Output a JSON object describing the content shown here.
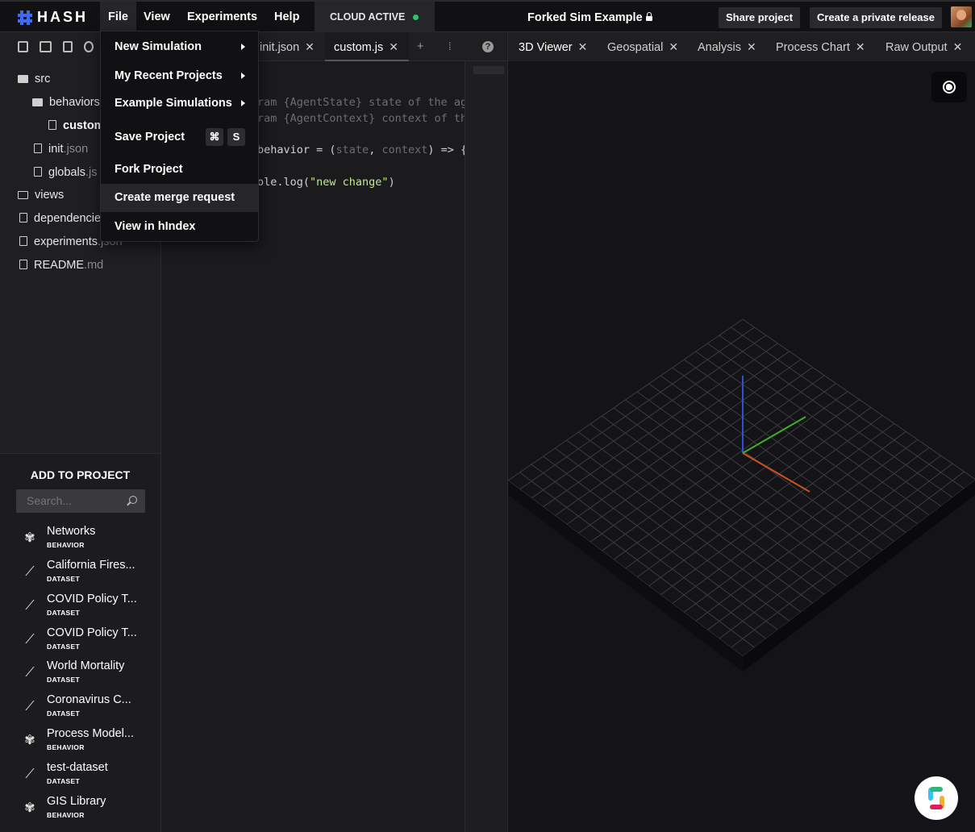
{
  "topbar": {
    "logo": "HASH",
    "menus": [
      "File",
      "View",
      "Experiments",
      "Help"
    ],
    "cloud_status": "CLOUD ACTIVE",
    "project_title": "Forked Sim Example",
    "share_label": "Share project",
    "release_label": "Create a private release"
  },
  "file_menu": {
    "items": [
      {
        "label": "New Simulation",
        "submenu": true
      },
      {
        "label": "My Recent Projects",
        "submenu": true
      },
      {
        "label": "Example Simulations",
        "submenu": true
      },
      {
        "label": "Save Project",
        "shortcut": [
          "⌘",
          "S"
        ]
      },
      {
        "label": "Fork Project"
      },
      {
        "label": "Create merge request"
      },
      {
        "label": "View in hIndex"
      }
    ]
  },
  "file_tree": {
    "src": "src",
    "behaviors": "behaviors",
    "custom": "custom",
    "init_name": "init",
    "init_ext": ".json",
    "globals_name": "globals",
    "globals_ext": ".js",
    "views": "views",
    "dependencies": "dependencie",
    "experiments_name": "experiments",
    "experiments_ext": ".json",
    "readme_name": "README",
    "readme_ext": ".md"
  },
  "add_panel": {
    "title": "ADD TO PROJECT",
    "search_placeholder": "Search...",
    "items": [
      {
        "name": "Networks",
        "type": "BEHAVIOR",
        "icon": "brain-icon"
      },
      {
        "name": "California Fires...",
        "type": "DATASET",
        "icon": "trend-icon"
      },
      {
        "name": "COVID Policy T...",
        "type": "DATASET",
        "icon": "trend-icon"
      },
      {
        "name": "COVID Policy T...",
        "type": "DATASET",
        "icon": "trend-icon"
      },
      {
        "name": "World Mortality",
        "type": "DATASET",
        "icon": "trend-icon"
      },
      {
        "name": "Coronavirus C...",
        "type": "DATASET",
        "icon": "trend-icon"
      },
      {
        "name": "Process Model...",
        "type": "BEHAVIOR",
        "icon": "brain-icon"
      },
      {
        "name": "test-dataset",
        "type": "DATASET",
        "icon": "trend-icon"
      },
      {
        "name": "GIS Library",
        "type": "BEHAVIOR",
        "icon": "brain-icon"
      }
    ]
  },
  "editor": {
    "tabs": [
      "init.json",
      "custom.js"
    ],
    "code": {
      "l1": "ram {AgentState} state of the age",
      "l2": "ram {AgentContext} context of the",
      "l3a": "behavior = (",
      "l3b": "state",
      "l3c": ", ",
      "l3d": "context",
      "l3e": ") => {",
      "l4a": "ole.log(",
      "l4b": "\"new change\"",
      "l4c": ")"
    }
  },
  "viewer": {
    "tabs": [
      "3D Viewer",
      "Geospatial",
      "Analysis",
      "Process Chart",
      "Raw Output"
    ]
  }
}
